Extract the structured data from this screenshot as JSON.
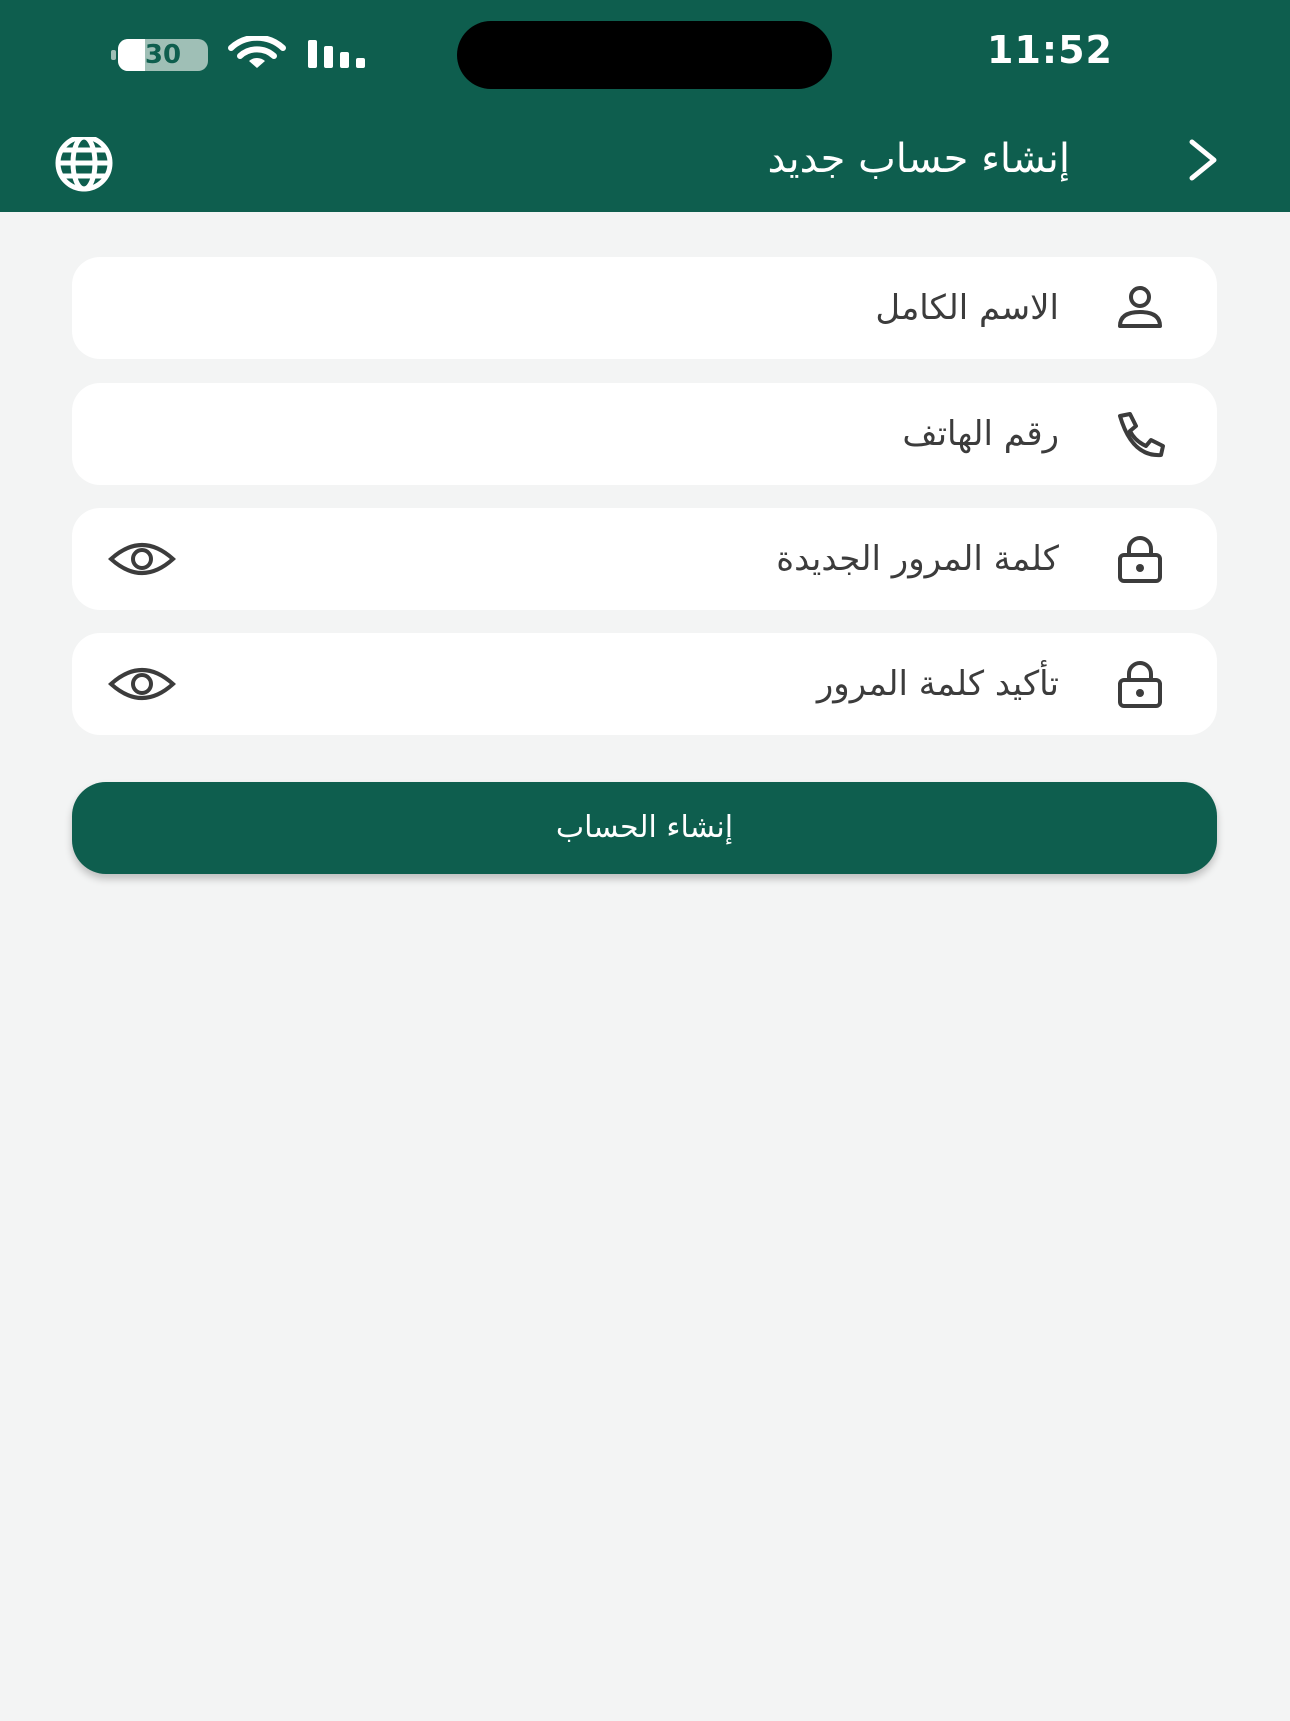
{
  "status_bar": {
    "time": "11:52",
    "battery_level": "30",
    "battery_fraction": 0.3
  },
  "header": {
    "title": "إنشاء حساب جديد",
    "back_icon": "chevron-right-icon",
    "language_icon": "globe-icon"
  },
  "form": {
    "full_name_placeholder": "الاسم الكامل",
    "phone_placeholder": "رقم الهاتف",
    "new_password_placeholder": "كلمة المرور الجديدة",
    "confirm_password_placeholder": "تأكيد كلمة المرور",
    "submit_label": "إنشاء الحساب"
  },
  "colors": {
    "primary": "#0e5e4e",
    "background": "#f3f4f4",
    "field_background": "#ffffff",
    "icon": "#3c3c3c"
  }
}
